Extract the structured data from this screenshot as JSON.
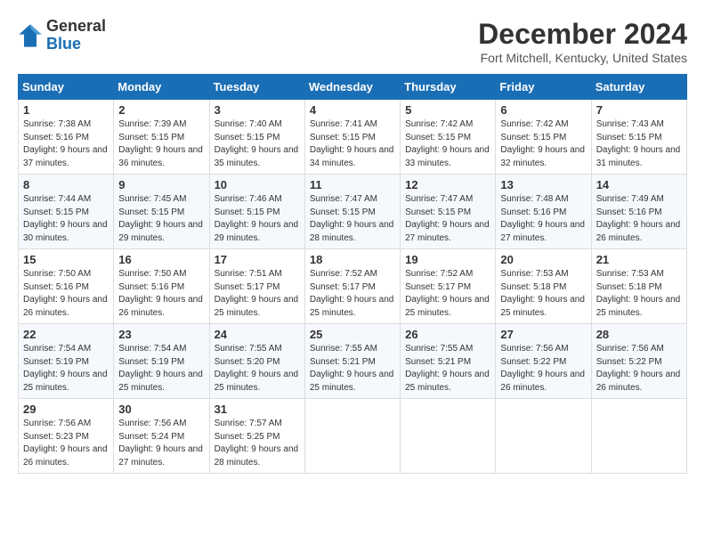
{
  "header": {
    "logo_line1": "General",
    "logo_line2": "Blue",
    "month_title": "December 2024",
    "location": "Fort Mitchell, Kentucky, United States"
  },
  "days_of_week": [
    "Sunday",
    "Monday",
    "Tuesday",
    "Wednesday",
    "Thursday",
    "Friday",
    "Saturday"
  ],
  "weeks": [
    [
      {
        "day": "1",
        "info": "Sunrise: 7:38 AM\nSunset: 5:16 PM\nDaylight: 9 hours and 37 minutes."
      },
      {
        "day": "2",
        "info": "Sunrise: 7:39 AM\nSunset: 5:15 PM\nDaylight: 9 hours and 36 minutes."
      },
      {
        "day": "3",
        "info": "Sunrise: 7:40 AM\nSunset: 5:15 PM\nDaylight: 9 hours and 35 minutes."
      },
      {
        "day": "4",
        "info": "Sunrise: 7:41 AM\nSunset: 5:15 PM\nDaylight: 9 hours and 34 minutes."
      },
      {
        "day": "5",
        "info": "Sunrise: 7:42 AM\nSunset: 5:15 PM\nDaylight: 9 hours and 33 minutes."
      },
      {
        "day": "6",
        "info": "Sunrise: 7:42 AM\nSunset: 5:15 PM\nDaylight: 9 hours and 32 minutes."
      },
      {
        "day": "7",
        "info": "Sunrise: 7:43 AM\nSunset: 5:15 PM\nDaylight: 9 hours and 31 minutes."
      }
    ],
    [
      {
        "day": "8",
        "info": "Sunrise: 7:44 AM\nSunset: 5:15 PM\nDaylight: 9 hours and 30 minutes."
      },
      {
        "day": "9",
        "info": "Sunrise: 7:45 AM\nSunset: 5:15 PM\nDaylight: 9 hours and 29 minutes."
      },
      {
        "day": "10",
        "info": "Sunrise: 7:46 AM\nSunset: 5:15 PM\nDaylight: 9 hours and 29 minutes."
      },
      {
        "day": "11",
        "info": "Sunrise: 7:47 AM\nSunset: 5:15 PM\nDaylight: 9 hours and 28 minutes."
      },
      {
        "day": "12",
        "info": "Sunrise: 7:47 AM\nSunset: 5:15 PM\nDaylight: 9 hours and 27 minutes."
      },
      {
        "day": "13",
        "info": "Sunrise: 7:48 AM\nSunset: 5:16 PM\nDaylight: 9 hours and 27 minutes."
      },
      {
        "day": "14",
        "info": "Sunrise: 7:49 AM\nSunset: 5:16 PM\nDaylight: 9 hours and 26 minutes."
      }
    ],
    [
      {
        "day": "15",
        "info": "Sunrise: 7:50 AM\nSunset: 5:16 PM\nDaylight: 9 hours and 26 minutes."
      },
      {
        "day": "16",
        "info": "Sunrise: 7:50 AM\nSunset: 5:16 PM\nDaylight: 9 hours and 26 minutes."
      },
      {
        "day": "17",
        "info": "Sunrise: 7:51 AM\nSunset: 5:17 PM\nDaylight: 9 hours and 25 minutes."
      },
      {
        "day": "18",
        "info": "Sunrise: 7:52 AM\nSunset: 5:17 PM\nDaylight: 9 hours and 25 minutes."
      },
      {
        "day": "19",
        "info": "Sunrise: 7:52 AM\nSunset: 5:17 PM\nDaylight: 9 hours and 25 minutes."
      },
      {
        "day": "20",
        "info": "Sunrise: 7:53 AM\nSunset: 5:18 PM\nDaylight: 9 hours and 25 minutes."
      },
      {
        "day": "21",
        "info": "Sunrise: 7:53 AM\nSunset: 5:18 PM\nDaylight: 9 hours and 25 minutes."
      }
    ],
    [
      {
        "day": "22",
        "info": "Sunrise: 7:54 AM\nSunset: 5:19 PM\nDaylight: 9 hours and 25 minutes."
      },
      {
        "day": "23",
        "info": "Sunrise: 7:54 AM\nSunset: 5:19 PM\nDaylight: 9 hours and 25 minutes."
      },
      {
        "day": "24",
        "info": "Sunrise: 7:55 AM\nSunset: 5:20 PM\nDaylight: 9 hours and 25 minutes."
      },
      {
        "day": "25",
        "info": "Sunrise: 7:55 AM\nSunset: 5:21 PM\nDaylight: 9 hours and 25 minutes."
      },
      {
        "day": "26",
        "info": "Sunrise: 7:55 AM\nSunset: 5:21 PM\nDaylight: 9 hours and 25 minutes."
      },
      {
        "day": "27",
        "info": "Sunrise: 7:56 AM\nSunset: 5:22 PM\nDaylight: 9 hours and 26 minutes."
      },
      {
        "day": "28",
        "info": "Sunrise: 7:56 AM\nSunset: 5:22 PM\nDaylight: 9 hours and 26 minutes."
      }
    ],
    [
      {
        "day": "29",
        "info": "Sunrise: 7:56 AM\nSunset: 5:23 PM\nDaylight: 9 hours and 26 minutes."
      },
      {
        "day": "30",
        "info": "Sunrise: 7:56 AM\nSunset: 5:24 PM\nDaylight: 9 hours and 27 minutes."
      },
      {
        "day": "31",
        "info": "Sunrise: 7:57 AM\nSunset: 5:25 PM\nDaylight: 9 hours and 28 minutes."
      },
      {
        "day": "",
        "info": ""
      },
      {
        "day": "",
        "info": ""
      },
      {
        "day": "",
        "info": ""
      },
      {
        "day": "",
        "info": ""
      }
    ]
  ]
}
